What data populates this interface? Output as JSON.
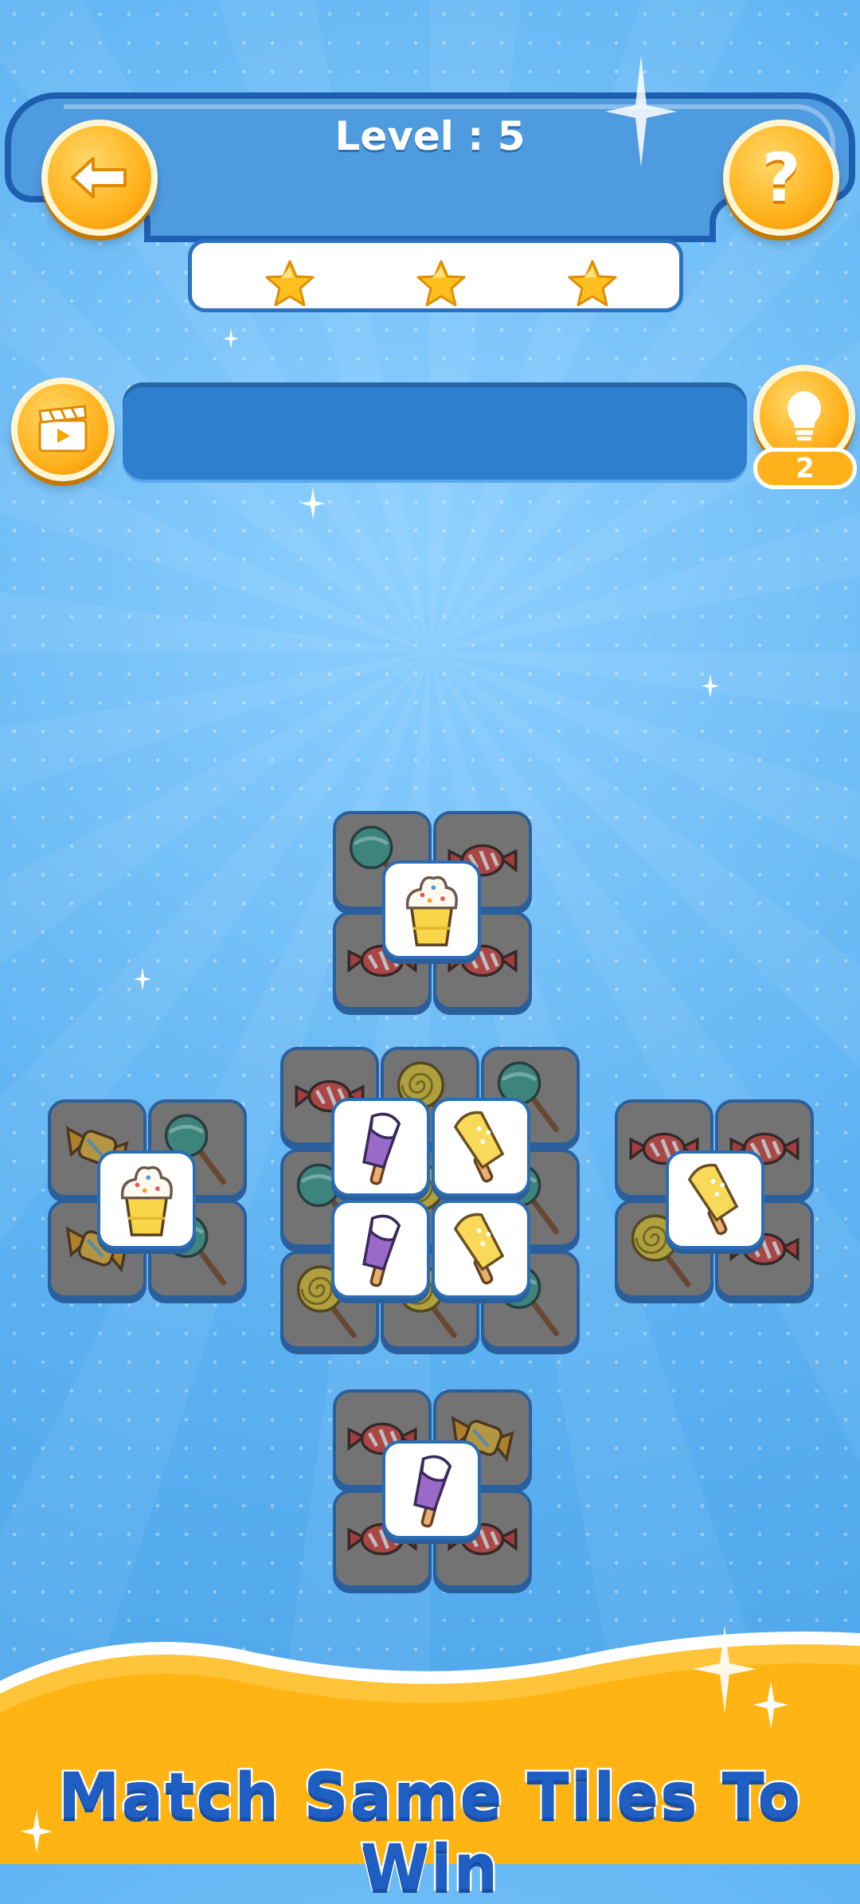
{
  "header": {
    "level_text": "Level : 5",
    "back_icon": "back-arrow-icon",
    "help_icon": "question-icon",
    "help_symbol": "?"
  },
  "stars": {
    "count": 3,
    "icon": "star-icon"
  },
  "controls": {
    "video_icon": "video-clapper-icon",
    "hint_icon": "lightbulb-icon",
    "hint_count": "2"
  },
  "board": {
    "tile_types": [
      "lollipop",
      "candy",
      "ice-cream-cup",
      "popsicle-purple",
      "popsicle-yellow",
      "spiral-lollipop",
      "wrapped-candy"
    ]
  },
  "footer": {
    "tagline": "Match Same Tiles To Win"
  },
  "colors": {
    "accent": "#ffb21c",
    "primary_blue": "#2e7fcd",
    "tagline_blue": "#1f5fc4"
  }
}
